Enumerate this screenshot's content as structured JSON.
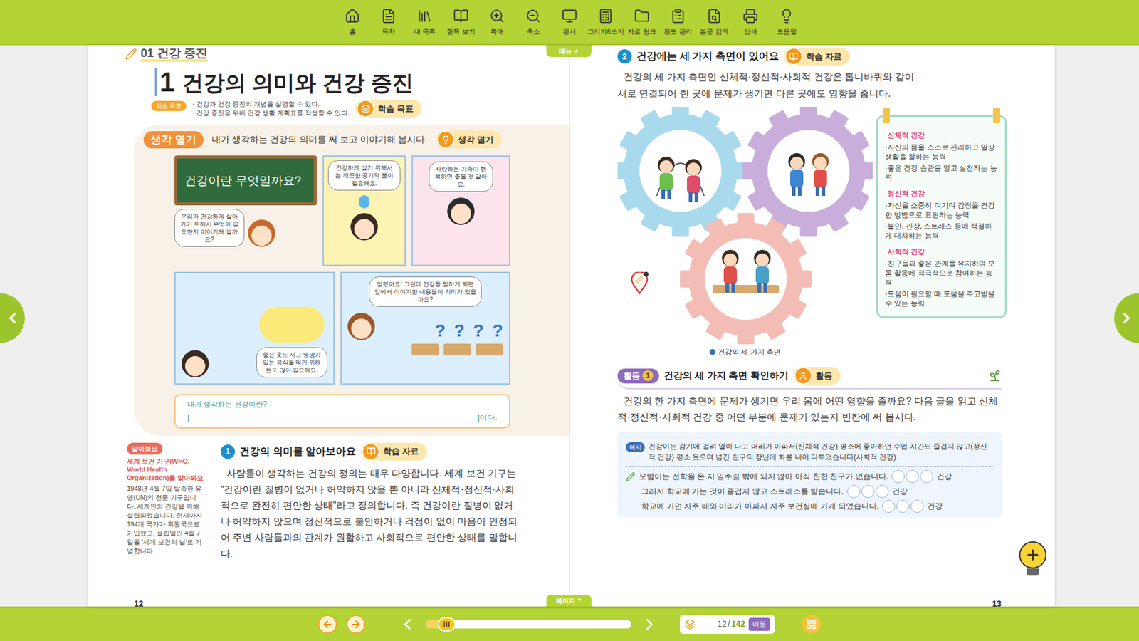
{
  "toolbar": {
    "items": [
      {
        "label": "홈"
      },
      {
        "label": "목차"
      },
      {
        "label": "내 목록"
      },
      {
        "label": "한쪽 보기"
      },
      {
        "label": "확대"
      },
      {
        "label": "축소"
      },
      {
        "label": "판서"
      },
      {
        "label": "그리기&쓰기"
      },
      {
        "label": "자료 링크"
      },
      {
        "label": "진도 관리"
      },
      {
        "label": "본문 검색"
      },
      {
        "label": "인쇄"
      },
      {
        "label": "도움말"
      }
    ]
  },
  "viewer": {
    "menu_tab": {
      "label": "메뉴",
      "arrow": "▲"
    },
    "page_tab": {
      "label": "페이지",
      "arrow": "▼"
    }
  },
  "left_page": {
    "unit_number": "01",
    "unit_title": "건강 증진",
    "lesson_number": "1",
    "lesson_title": "건강의 의미와 건강 증진",
    "objectives": {
      "badge": "학습 목표",
      "items": [
        "· 건강과 건강 증진의 개념을 설명할 수 있다.",
        "· 건강 증진을 위해 건강 생활 계획표를 작성할 수 있다."
      ],
      "button": "학습 목표"
    },
    "thinking": {
      "badge": "생각 열기",
      "prompt": "내가 생각하는 건강의 의미를 써 보고 이야기해 봅시다.",
      "button": "생각 열기",
      "comic": {
        "board": "건강이란 무엇일까요?",
        "teacher_bubble": "우리가 건강하게 살아가기 위해서 무엇이 필요한지 이야기해 볼까요?",
        "bubbles": [
          "건강하게 살기 위해서는 깨끗한 공기와 물이 필요해요.",
          "사랑하는 가족이 행복하면 좋을 것 같아요.",
          "좋은 옷도 사고 영양가 있는 음식을 먹기 위해 돈도 많이 필요해요.",
          "잘했어요! 그런데 건강을 말하게 되면 앞에서 이야기한 내용들이 의미가 있을까요?"
        ],
        "marks": [
          "?",
          "?",
          "?",
          "?"
        ]
      },
      "answer": {
        "label": "내가 생각하는 건강이란?",
        "open": "[",
        "close": "]이다."
      }
    },
    "note": {
      "badge": "알아봐요",
      "title": "세계 보건 기구(WHO, World Health Organization)를 알아봐요",
      "body": "1948년 4월 7일 발족한 유엔(UN)의 전문 기구입니다. 세계인의 건강을 위해 설립되었습니다. 현재까지 194개 국가가 회원국으로 가입했고, 설립일인 4월 7일을 '세계 보건의 날'로 기념합니다."
    },
    "section": {
      "number": "1",
      "title": "건강의 의미를 알아보아요",
      "button": "학습 자료",
      "paragraph": "사람들이 생각하는 건강의 정의는 매우 다양합니다. 세계 보건 기구는 “건강이란 질병이 없거나 허약하지 않을 뿐 아니라 신체적·정신적·사회적으로 완전히 편안한 상태”라고 정의합니다. 즉 건강이란 질병이 없거나 허약하지 않으며 정신적으로 불안하거나 걱정이 없이 마음이 안정되어 주변 사람들과의 관계가 원활하고 사회적으로 편안한 상태를 말합니다."
    },
    "page_number": "12"
  },
  "right_page": {
    "section": {
      "number": "2",
      "title": "건강에는 세 가지 측면이 있어요",
      "button": "학습 자료",
      "paragraph": "건강의 세 가지 측면인 신체적·정신적·사회적 건강은 톱니바퀴와 같이 서로 연결되어 한 곳에 문제가 생기면 다른 곳에도 영향을 줍니다."
    },
    "figure": {
      "caption": "건강의 세 가지 측면",
      "aspects": [
        {
          "title": "신체적 건강",
          "color": "#a9d9ec",
          "items": [
            "·자신의 몸을 스스로 관리하고 일상생활을 잘하는 능력",
            "·좋은 건강 습관을 알고 실천하는 능력"
          ]
        },
        {
          "title": "정신적 건강",
          "color": "#c9aedb",
          "items": [
            "·자신을 소중히 여기며 감정을 건강한 방법으로 표현하는 능력",
            "·불안, 긴장, 스트레스 등에 적절하게 대처하는 능력"
          ]
        },
        {
          "title": "사회적 건강",
          "color": "#f3bdb5",
          "items": [
            "·친구들과 좋은 관계를 유지하며 모둠 활동에 적극적으로 참여하는 능력",
            "·도움이 필요할 때 도움을 주고받을 수 있는 능력"
          ]
        }
      ]
    },
    "activity": {
      "badge": "활동",
      "number": "1",
      "title": "건강의 세 가지 측면 확인하기",
      "button": "활동",
      "paragraph": "건강의 한 가지 측면에 문제가 생기면 우리 몸에 어떤 영향을 줄까요? 다음 글을 읽고 신체적·정신적·사회적 건강 중 어떤 부분에 문제가 있는지 빈칸에 써 봅시다.",
      "example": {
        "badge": "예시",
        "text": "건강이는 감기에 걸려 열이 나고 머리가 아파서(신체적 건강) 평소에 좋아하던 수업 시간도 즐겁지 않고(정신적 건강) 평소 웃으며 넘긴 친구의 장난에 화를 내어 다투었습니다(사회적 건강)."
      },
      "lines": [
        {
          "text": "모범이는 전학을 온 지 일주일 밖에 되지 않아 아직 친한 친구가 없습니다.",
          "suffix": "건강"
        },
        {
          "text": "그래서 학교에 가는 것이 즐겁지 않고 스트레스를 받습니다.",
          "suffix": "건강"
        },
        {
          "text": "학교에 가면 자주 배와 머리가 아파서 자주 보건실에 가게 되었습니다.",
          "suffix": "건강"
        }
      ]
    },
    "page_number": "13"
  },
  "bottom_bar": {
    "slider": {
      "level": 0.08
    },
    "page_current": "12",
    "page_separator": "/",
    "page_total": "142",
    "go_button": "이동"
  }
}
